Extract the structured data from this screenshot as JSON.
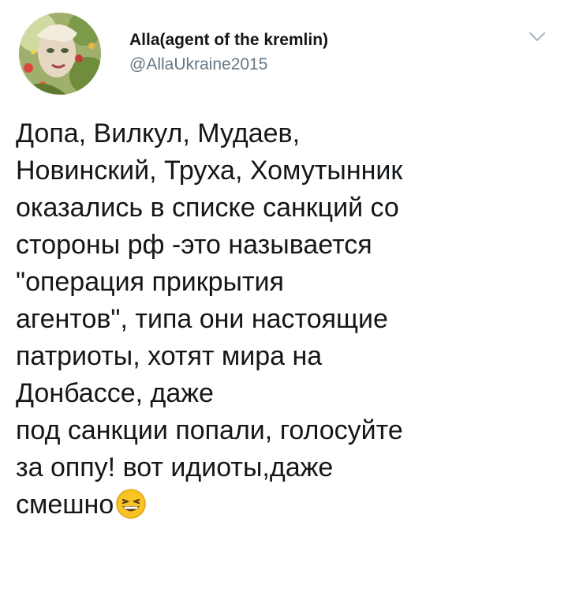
{
  "tweet": {
    "display_name": "Alla(agent of the kremlin)",
    "handle": "@AllaUkraine2015",
    "lines": [
      "Допа, Вилкул, Мудаев,",
      "Новинский, Труха, Хомутынник",
      "оказались в списке санкций со",
      "стороны рф -это называется",
      "\"операция прикрытия",
      "агентов\", типа они настоящие",
      "патриоты, хотят мира на",
      "Донбассе, даже",
      "под санкции попали, голосуйте",
      "за оппу! вот идиоты,даже",
      "смешно"
    ],
    "end_emoji": "grinning-squinting-face-emoji"
  },
  "colors": {
    "text": "#14171a",
    "secondary": "#657786",
    "caret": "#aab8c2",
    "emoji_yellow": "#f7c325"
  },
  "icons": {
    "menu": "chevron-down-icon",
    "avatar": "avatar"
  }
}
